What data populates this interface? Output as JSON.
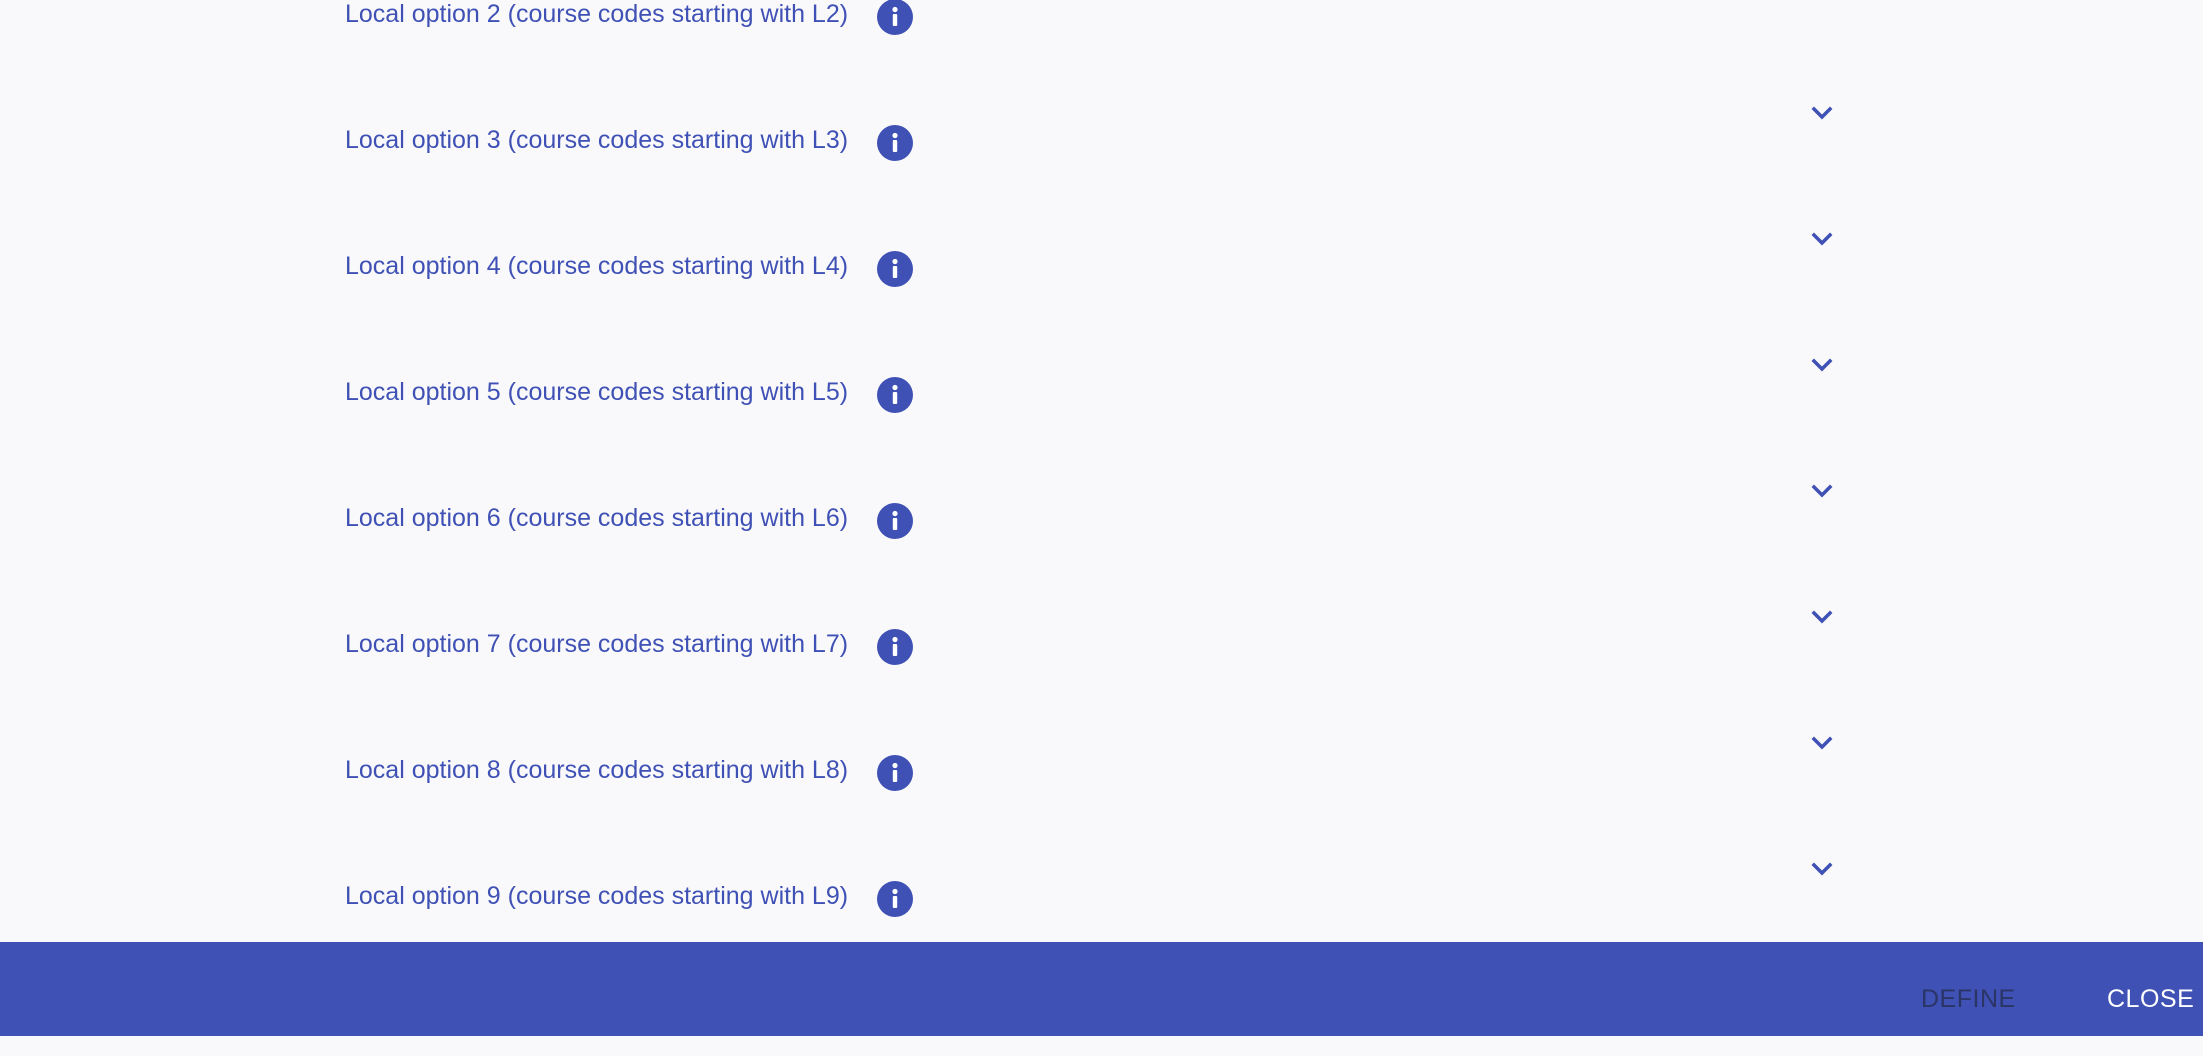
{
  "options": [
    {
      "label": "Local option 2 (course codes starting with L2)",
      "info_icon": "info-icon",
      "expand_icon": "chevron-down-icon"
    },
    {
      "label": "Local option 3 (course codes starting with L3)",
      "info_icon": "info-icon",
      "expand_icon": "chevron-down-icon"
    },
    {
      "label": "Local option 4 (course codes starting with L4)",
      "info_icon": "info-icon",
      "expand_icon": "chevron-down-icon"
    },
    {
      "label": "Local option 5 (course codes starting with L5)",
      "info_icon": "info-icon",
      "expand_icon": "chevron-down-icon"
    },
    {
      "label": "Local option 6 (course codes starting with L6)",
      "info_icon": "info-icon",
      "expand_icon": "chevron-down-icon"
    },
    {
      "label": "Local option 7 (course codes starting with L7)",
      "info_icon": "info-icon",
      "expand_icon": "chevron-down-icon"
    },
    {
      "label": "Local option 8 (course codes starting with L8)",
      "info_icon": "info-icon",
      "expand_icon": "chevron-down-icon"
    },
    {
      "label": "Local option 9 (course codes starting with L9)",
      "info_icon": "info-icon",
      "expand_icon": "chevron-down-icon"
    }
  ],
  "footer": {
    "define_label": "DEFINE",
    "define_enabled": false,
    "close_label": "CLOSE"
  },
  "colors": {
    "accent": "#3f51b5",
    "background": "#f9f9fb",
    "disabled_text": "#2a3566",
    "footer_text": "#ffffff"
  }
}
